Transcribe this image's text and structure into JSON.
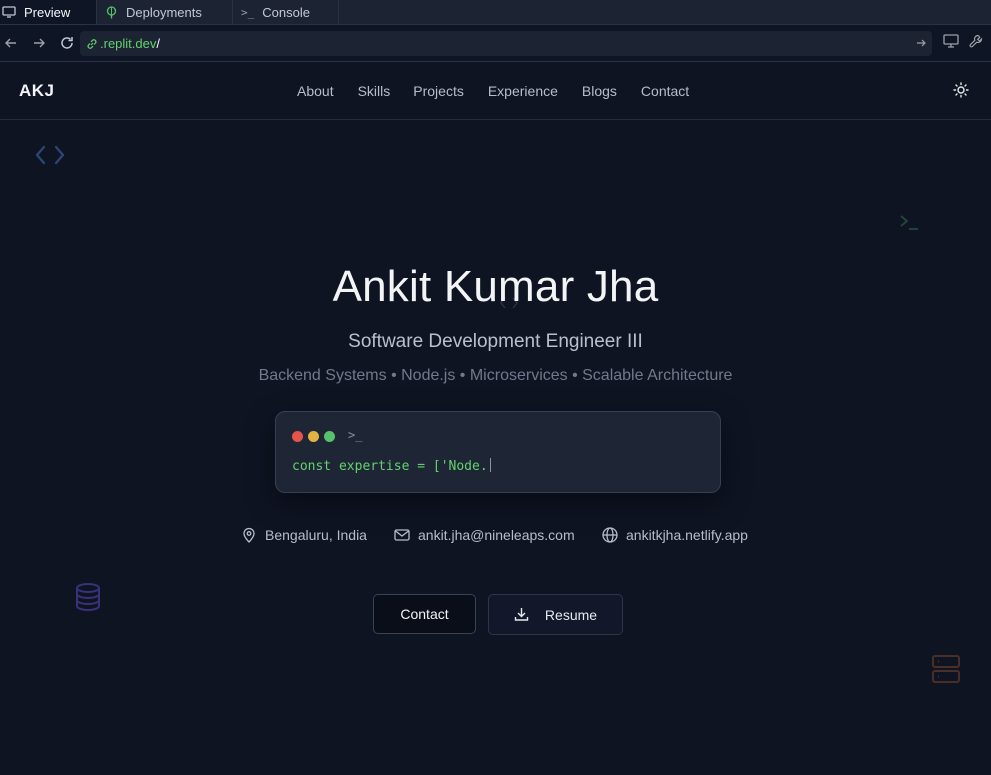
{
  "tabs": [
    {
      "label": "Preview",
      "icon": "monitor-icon"
    },
    {
      "label": "Deployments",
      "icon": "deploy-icon"
    },
    {
      "label": "Console",
      "icon": "terminal-icon"
    }
  ],
  "address": {
    "domain": ".replit.dev",
    "path": "/"
  },
  "site": {
    "logo": "AKJ",
    "nav": [
      "About",
      "Skills",
      "Projects",
      "Experience",
      "Blogs",
      "Contact"
    ]
  },
  "hero": {
    "name": "Ankit Kumar Jha",
    "role": "Software Development Engineer III",
    "stack": "Backend Systems • Node.js • Microservices • Scalable Architecture",
    "terminal": {
      "prompt": ">_",
      "code": "const expertise = ['Node."
    },
    "location": "Bengaluru, India",
    "email": "ankit.jha@nineleaps.com",
    "website": "ankitkjha.netlify.app",
    "contact_button": "Contact",
    "resume_button": "Resume"
  },
  "colors": {
    "background": "#0f1423",
    "accent_green": "#64d26d",
    "dot_red": "#e5534b",
    "dot_yellow": "#e3b341",
    "dot_green": "#57c06a"
  }
}
